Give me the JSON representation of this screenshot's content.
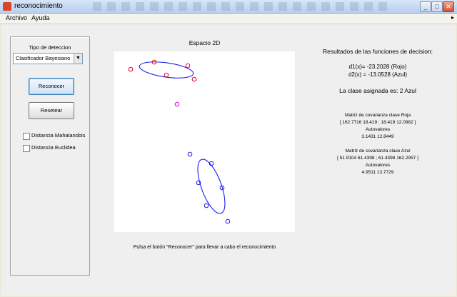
{
  "window": {
    "title": "reconocimiento"
  },
  "menu": {
    "items": [
      "Archivo",
      "Ayuda"
    ]
  },
  "controls": {
    "detection_label": "Tipo de deteccion",
    "detection_selected": "Clasificador Bayesiano",
    "recognize_button": "Reconocer",
    "reset_button": "Resetear",
    "mahalanobis_label": "Distancia Mahalanobis",
    "mahalanobis_checked": false,
    "euclidean_label": "Distancia Euclidea",
    "euclidean_checked": false
  },
  "plot": {
    "title": "Espacio 2D",
    "instruction": "Pulsa el botón \"Reconocer\" para llevar a cabo el reconocimiento",
    "colors": {
      "red": "#e8002a",
      "blue": "#1c1cf0",
      "magenta": "#e000e0"
    }
  },
  "results": {
    "heading": "Resultados de las funciones de decision:",
    "d1": "d1(x)= -23.2028  (Rojo)",
    "d2": "d2(x) = -13.0528  (Azul)",
    "assigned": "La clase asignada es: 2 Azul",
    "red_cov_title": "Matriz de covarianza clase Roja",
    "red_cov_values": "[ 162.7716 18.419 ; 18.419 12.0982 ]",
    "red_eig_title": "Autovalores",
    "red_eig_values": "3.1431     12.8449",
    "blue_cov_title": "Matriz de covarianza clase Azul",
    "blue_cov_values": "[ 51.9104 61.4398 ; 61.4398 162.2957 ]",
    "blue_eig_title": "Autovalores",
    "blue_eig_values": "4.9511     13.7729"
  }
}
